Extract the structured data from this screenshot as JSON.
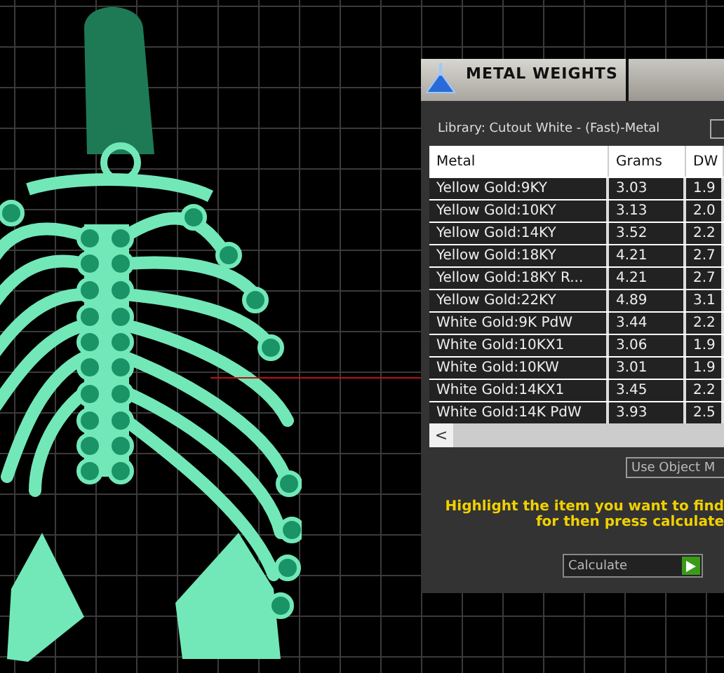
{
  "panel": {
    "title": "METAL WEIGHTS",
    "library": "Library: Cutout White - (Fast)-Metal",
    "table": {
      "columns": [
        "Metal",
        "Grams",
        "DW"
      ],
      "rows": [
        [
          "Yellow Gold:9KY",
          "3.03",
          "1.9"
        ],
        [
          "Yellow Gold:10KY",
          "3.13",
          "2.0"
        ],
        [
          "Yellow Gold:14KY",
          "3.52",
          "2.2"
        ],
        [
          "Yellow Gold:18KY",
          "4.21",
          "2.7"
        ],
        [
          "Yellow Gold:18KY R...",
          "4.21",
          "2.7"
        ],
        [
          "Yellow Gold:22KY",
          "4.89",
          "3.1"
        ],
        [
          "White Gold:9K PdW",
          "3.44",
          "2.2"
        ],
        [
          "White Gold:10KX1",
          "3.06",
          "1.9"
        ],
        [
          "White Gold:10KW",
          "3.01",
          "1.9"
        ],
        [
          "White Gold:14KX1",
          "3.45",
          "2.2"
        ],
        [
          "White Gold:14K PdW",
          "3.93",
          "2.5"
        ]
      ]
    },
    "scroll_left": "<",
    "use_object_button": "Use Object M",
    "hint": [
      "Highlight the item you want to find",
      "for then press calculate"
    ],
    "calculate": "Calculate"
  }
}
